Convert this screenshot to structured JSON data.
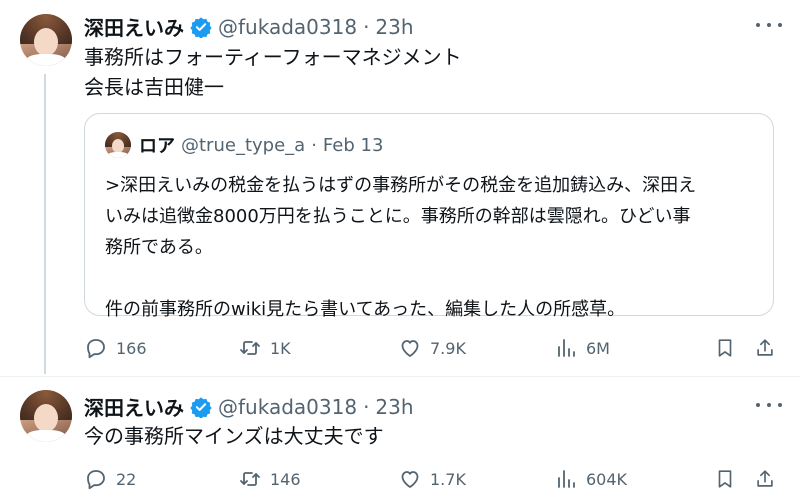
{
  "tweets": [
    {
      "name": "深田えいみ",
      "handle": "@fukada0318",
      "separator": "·",
      "time": "23h",
      "text": "事務所はフォーティーフォーマネジメント\n会長は吉田健一",
      "quote": {
        "name": "ロア",
        "handle": "@true_type_a",
        "separator": "·",
        "time": "Feb 13",
        "text": ">深田えいみの税金を払うはずの事務所がその税金を追加鋳込み、深田え\nいみは追徴金8000万円を払うことに。事務所の幹部は雲隠れ。ひどい事\n務所である。\n\n件の前事務所のwiki見たら書いてあった、編集した人の所感草。"
      },
      "actions": {
        "replies": "166",
        "reposts": "1K",
        "likes": "7.9K",
        "views": "6M"
      }
    },
    {
      "name": "深田えいみ",
      "handle": "@fukada0318",
      "separator": "·",
      "time": "23h",
      "text": "今の事務所マインズは大丈夫です",
      "actions": {
        "replies": "22",
        "reposts": "146",
        "likes": "1.7K",
        "views": "604K"
      }
    }
  ],
  "colors": {
    "verified": "#1d9bf0",
    "secondary_text": "#536471",
    "border": "#cfd9de"
  },
  "icons": [
    "reply-icon",
    "repost-icon",
    "like-icon",
    "views-icon",
    "bookmark-icon",
    "share-icon",
    "more-icon",
    "verified-badge-icon"
  ]
}
